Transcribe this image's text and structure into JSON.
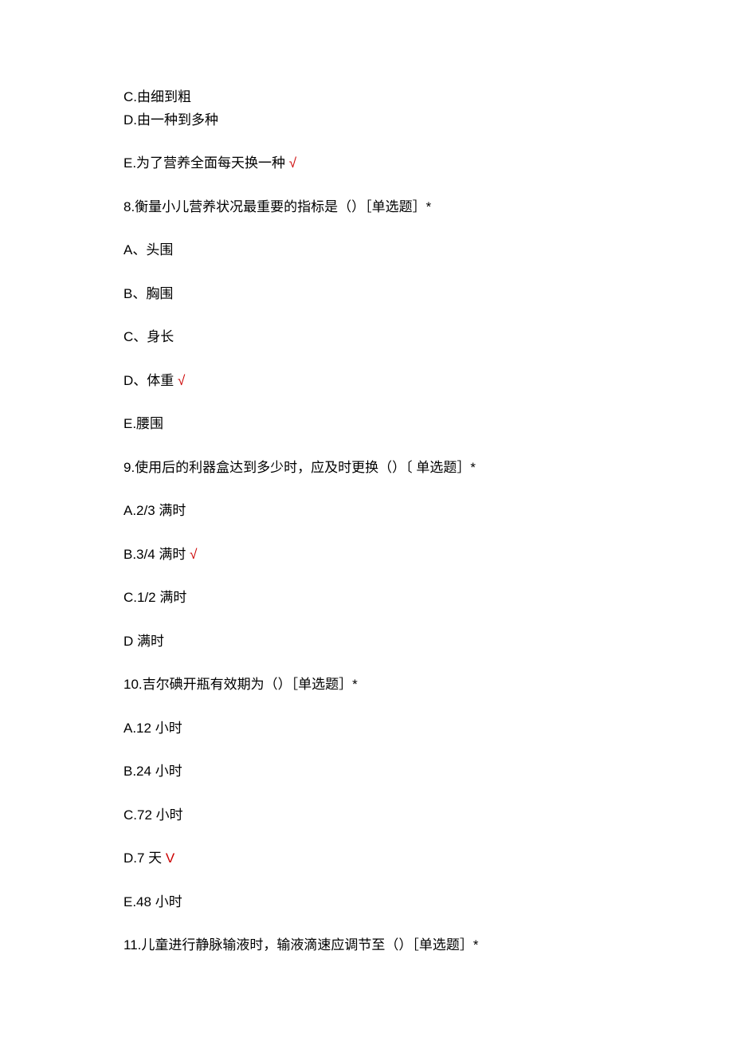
{
  "q7": {
    "c": "C.由细到粗",
    "d": "D.由一种到多种",
    "e_text": "E.为了营养全面每天换一种 ",
    "e_check": "√"
  },
  "q8": {
    "stem": "8.衡量小儿营养状况最重要的指标是（）［单选题］*",
    "a": "A、头围",
    "b": "B、胸围",
    "c": "C、身长",
    "d_text": "D、体重 ",
    "d_check": "√",
    "e": "E.腰围"
  },
  "q9": {
    "stem": "9.使用后的利器盒达到多少时，应及时更换（）〔 单选题］*",
    "a": "A.2/3 满时",
    "b_text": "B.3/4 满时 ",
    "b_check": "√",
    "c": "C.1/2 满时",
    "d": "D 满时"
  },
  "q10": {
    "stem": "10.吉尔碘开瓶有效期为（）［单选题］*",
    "a": "A.12 小时",
    "b": "B.24 小时",
    "c": "C.72 小时",
    "d_text": "D.7 天 ",
    "d_check": "V",
    "e": "E.48 小时"
  },
  "q11": {
    "stem": "11.儿童进行静脉输液时，输液滴速应调节至（）［单选题］*"
  }
}
